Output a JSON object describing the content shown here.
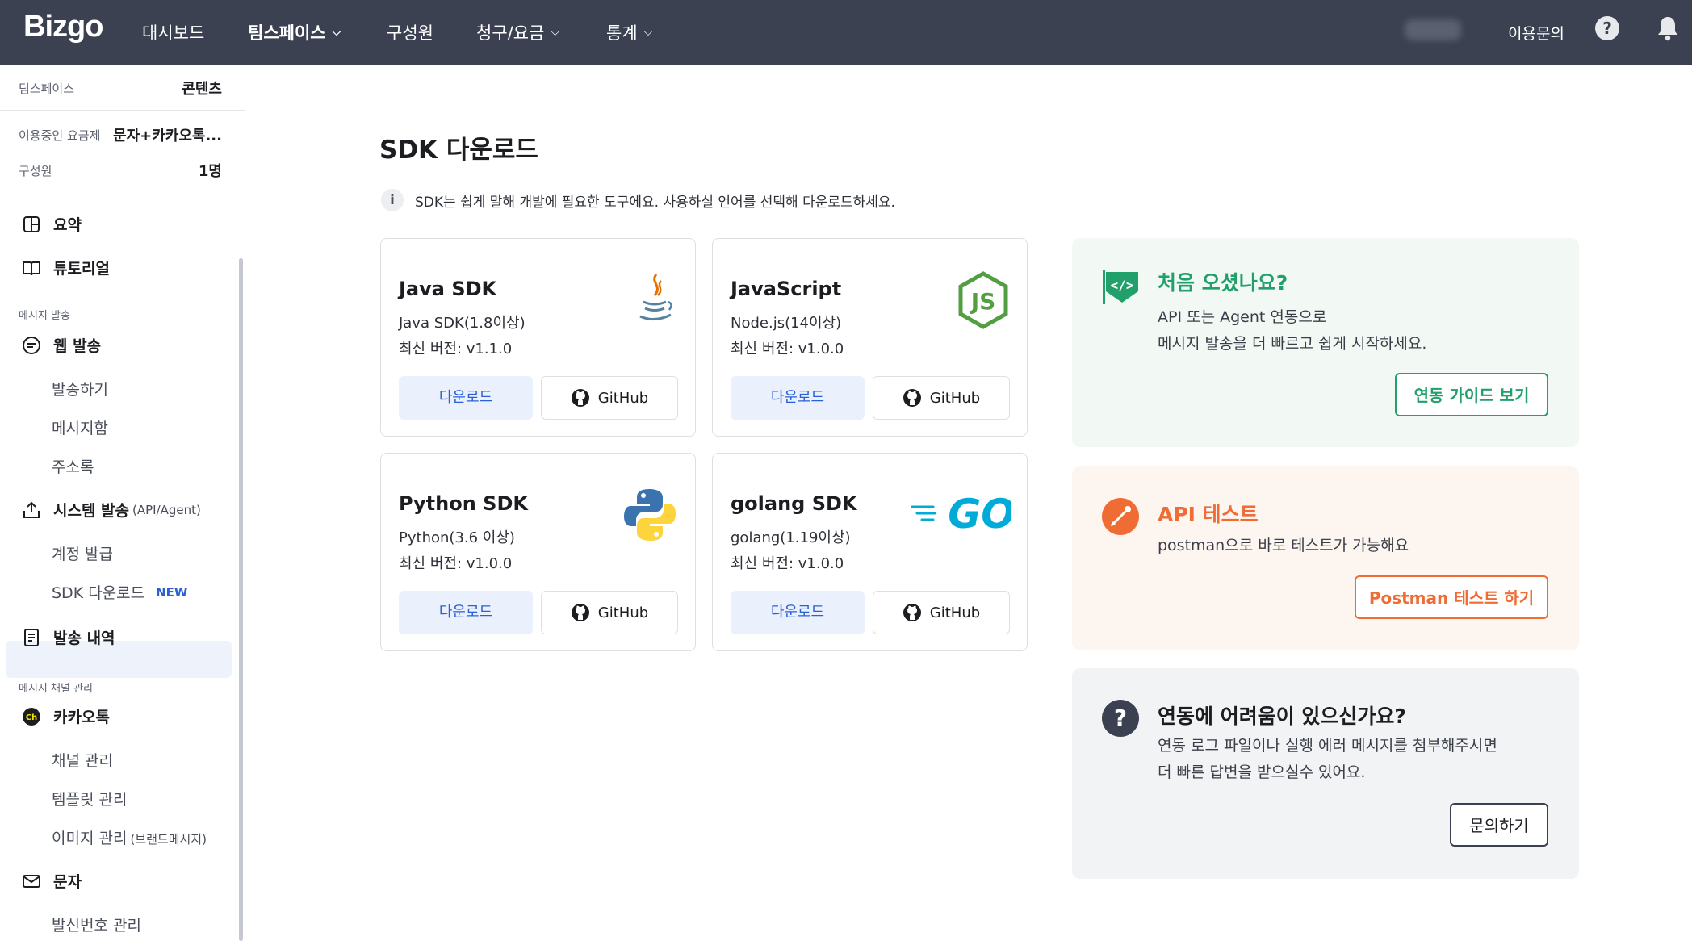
{
  "header": {
    "logo": "Bizgo",
    "nav": [
      {
        "label": "대시보드",
        "dropdown": false
      },
      {
        "label": "팀스페이스",
        "dropdown": true
      },
      {
        "label": "구성원",
        "dropdown": false
      },
      {
        "label": "청구/요금",
        "dropdown": true
      },
      {
        "label": "통계",
        "dropdown": true
      }
    ],
    "inquiry": "이용문의"
  },
  "sidebar": {
    "teamspace_key": "팀스페이스",
    "teamspace_val": "콘텐츠",
    "plan_key": "이용중인 요금제",
    "plan_val": "문자+카카오톡...",
    "members_key": "구성원",
    "members_val": "1명",
    "summary": "요약",
    "tutorial": "튜토리얼",
    "section_send": "메시지 발송",
    "web_send": "웹 발송",
    "send": "발송하기",
    "msgbox": "메시지함",
    "address": "주소록",
    "system_send": "시스템 발송",
    "system_send_sub": "(API/Agent)",
    "account": "계정 발급",
    "sdk": "SDK 다운로드",
    "new_badge": "NEW",
    "history": "발송 내역",
    "section_channel": "메시지 채널 관리",
    "kakao": "카카오톡",
    "channel_mgmt": "채널 관리",
    "template_mgmt": "템플릿 관리",
    "image_mgmt": "이미지 관리",
    "image_mgmt_sub": "(브랜드메시지)",
    "sms": "문자",
    "sender_mgmt": "발신번호 관리"
  },
  "main": {
    "title": "SDK 다운로드",
    "info": "SDK는 쉽게 말해 개발에 필요한 도구에요. 사용하실 언어를 선택해 다운로드하세요.",
    "download_label": "다운로드",
    "github_label": "GitHub",
    "sdks": [
      {
        "name": "Java SDK",
        "requirement": "Java SDK(1.8이상)",
        "version": "최신 버전: v1.1.0",
        "icon": "java-logo"
      },
      {
        "name": "JavaScript",
        "requirement": "Node.js(14이상)",
        "version": "최신 버전: v1.0.0",
        "icon": "nodejs-logo"
      },
      {
        "name": "Python SDK",
        "requirement": "Python(3.6 이상)",
        "version": "최신 버전: v1.0.0",
        "icon": "python-logo"
      },
      {
        "name": "golang SDK",
        "requirement": "golang(1.19이상)",
        "version": "최신 버전: v1.0.0",
        "icon": "go-logo"
      }
    ]
  },
  "promos": {
    "first": {
      "title": "처음 오셨나요?",
      "line1": "API 또는 Agent 연동으로",
      "line2": "메시지 발송을 더 빠르고 쉽게 시작하세요.",
      "button": "연동 가이드 보기",
      "color": "#22a06b"
    },
    "api": {
      "title": "API 테스트",
      "line1": "postman으로 바로 테스트가 가능해요",
      "button": "Postman 테스트 하기",
      "color": "#ef6c35"
    },
    "help": {
      "title": "연동에 어려움이 있으신가요?",
      "line1": "연동 로그 파일이나 실행 에러 메시지를 첨부해주시면",
      "line2": "더 빠른 답변을 받으실수 있어요.",
      "button": "문의하기"
    }
  },
  "colors": {
    "topbar": "#3b4150",
    "accent": "#2a5fd6"
  }
}
